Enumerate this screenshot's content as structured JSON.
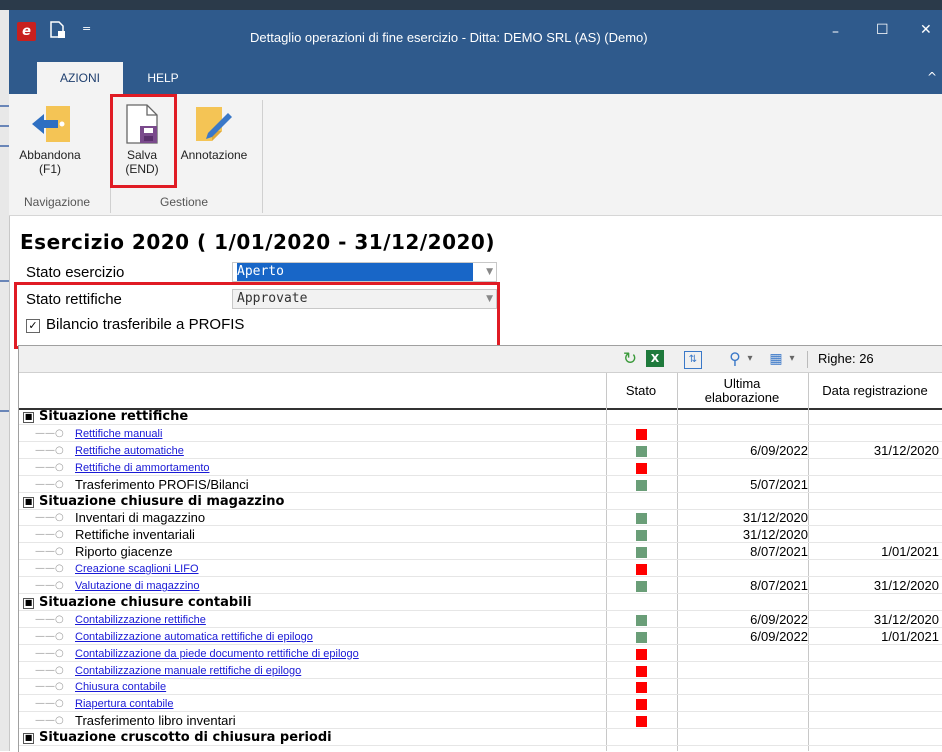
{
  "window": {
    "title": "Dettaglio operazioni di fine esercizio - Ditta: DEMO SRL (AS)  (Demo)",
    "app_icon_letter": "e",
    "qat_menu": "=",
    "minimize": "–",
    "maximize": "☐",
    "close": "✕",
    "collapse": "^"
  },
  "tabs": [
    {
      "label": "AZIONI",
      "active": true
    },
    {
      "label": "HELP",
      "active": false
    }
  ],
  "ribbon": {
    "buttons": [
      {
        "label1": "Abbandona",
        "label2": "(F1)",
        "icon": "arrow-left-icon"
      },
      {
        "label1": "Salva",
        "label2": "(END)",
        "icon": "save-icon"
      },
      {
        "label1": "Annotazione",
        "label2": "",
        "icon": "note-pencil-icon"
      }
    ],
    "groups": [
      "Navigazione",
      "Gestione"
    ]
  },
  "heading": "Esercizio 2020 ( 1/01/2020 - 31/12/2020)",
  "form": {
    "stato_esercizio_label": "Stato esercizio",
    "stato_esercizio_value": "Aperto",
    "stato_rettifiche_label": "Stato rettifiche",
    "stato_rettifiche_value": "Approvate",
    "bilancio_label": "Bilancio trasferibile a PROFIS",
    "bilancio_checked": "✓"
  },
  "toolbar": {
    "righe": "Righe: 26",
    "dropdown": "▾"
  },
  "columns": {
    "stato": "Stato",
    "ultima1": "Ultima",
    "ultima2": "elaborazione",
    "data_reg": "Data registrazione"
  },
  "colors": {
    "red": "#ff0000",
    "green": "#6a9e78",
    "link": "#1a1ad6"
  },
  "rows": [
    {
      "type": "section",
      "name": "Situazione rettifiche",
      "toggle": "■"
    },
    {
      "type": "item",
      "name": "Rettifiche manuali",
      "link": true,
      "status": "red",
      "d1": "",
      "d2": ""
    },
    {
      "type": "item",
      "name": "Rettifiche automatiche",
      "link": true,
      "status": "green",
      "d1": "6/09/2022",
      "d2": "31/12/2020"
    },
    {
      "type": "item",
      "name": "Rettifiche di ammortamento",
      "link": true,
      "status": "red",
      "d1": "",
      "d2": ""
    },
    {
      "type": "item",
      "name": "Trasferimento PROFIS/Bilanci",
      "link": false,
      "status": "green",
      "d1": "5/07/2021",
      "d2": ""
    },
    {
      "type": "section",
      "name": "Situazione chiusure di magazzino",
      "toggle": "■"
    },
    {
      "type": "item",
      "name": "Inventari di magazzino",
      "link": false,
      "status": "green",
      "d1": "31/12/2020",
      "d2": ""
    },
    {
      "type": "item",
      "name": "Rettifiche inventariali",
      "link": false,
      "status": "green",
      "d1": "31/12/2020",
      "d2": ""
    },
    {
      "type": "item",
      "name": "Riporto giacenze",
      "link": false,
      "status": "green",
      "d1": "8/07/2021",
      "d2": "1/01/2021"
    },
    {
      "type": "item",
      "name": "Creazione scaglioni LIFO",
      "link": true,
      "status": "red",
      "d1": "",
      "d2": ""
    },
    {
      "type": "item",
      "name": "Valutazione di magazzino",
      "link": true,
      "status": "green",
      "d1": "8/07/2021",
      "d2": "31/12/2020"
    },
    {
      "type": "section",
      "name": "Situazione chiusure contabili",
      "toggle": "■"
    },
    {
      "type": "item",
      "name": "Contabilizzazione rettifiche",
      "link": true,
      "status": "green",
      "d1": "6/09/2022",
      "d2": "31/12/2020"
    },
    {
      "type": "item",
      "name": "Contabilizzazione automatica rettifiche di epilogo",
      "link": true,
      "status": "green",
      "d1": "6/09/2022",
      "d2": "1/01/2021"
    },
    {
      "type": "item",
      "name": "Contabilizzazione da piede documento rettifiche di epilogo",
      "link": true,
      "status": "red",
      "d1": "",
      "d2": ""
    },
    {
      "type": "item",
      "name": "Contabilizzazione manuale rettifiche di epilogo",
      "link": true,
      "status": "red",
      "d1": "",
      "d2": ""
    },
    {
      "type": "item",
      "name": "Chiusura contabile",
      "link": true,
      "status": "red",
      "d1": "",
      "d2": ""
    },
    {
      "type": "item",
      "name": "Riapertura contabile",
      "link": true,
      "status": "red",
      "d1": "",
      "d2": ""
    },
    {
      "type": "item",
      "name": "Trasferimento libro inventari",
      "link": false,
      "status": "red",
      "d1": "",
      "d2": ""
    },
    {
      "type": "section",
      "name": "Situazione cruscotto di chiusura periodi",
      "toggle": "■"
    }
  ]
}
